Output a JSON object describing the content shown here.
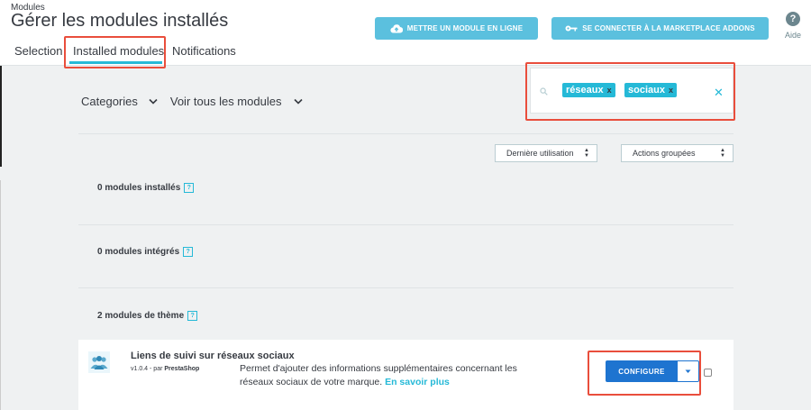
{
  "header": {
    "breadcrumb": "Modules",
    "title": "Gérer les modules installés",
    "tabs": [
      {
        "label": "Selection"
      },
      {
        "label": "Installed modules",
        "active": true
      },
      {
        "label": "Notifications"
      }
    ],
    "upload_button": "METTRE UN MODULE EN LIGNE",
    "connect_button": "SE CONNECTER À LA MARKETPLACE ADDONS",
    "help_label": "Aide"
  },
  "filters": {
    "categories_label": "Categories",
    "view_label": "Voir tous les modules"
  },
  "search": {
    "tags": [
      {
        "label": "réseaux",
        "remove": "x"
      },
      {
        "label": "sociaux",
        "remove": "x"
      }
    ],
    "clear": "✕"
  },
  "sort": {
    "last_used": "Dernière utilisation",
    "bulk_actions": "Actions groupées"
  },
  "sections": [
    {
      "title": "0 modules installés",
      "help": "?"
    },
    {
      "title": "0 modules intégrés",
      "help": "?"
    },
    {
      "title": "2 modules de thème",
      "help": "?"
    }
  ],
  "module": {
    "name": "Liens de suivi sur réseaux sociaux",
    "version": "v1.0.4",
    "by": "- par",
    "author": "PrestaShop",
    "description": "Permet d'ajouter des informations supplémentaires concernant les réseaux sociaux de votre marque.",
    "more": "En savoir plus",
    "configure_label": "CONFIGURE"
  },
  "colors": {
    "accent": "#25b9d7",
    "header_button": "#5bc0de",
    "primary": "#1e74d0",
    "highlight": "#e94e3c",
    "background": "#eff1f2"
  }
}
